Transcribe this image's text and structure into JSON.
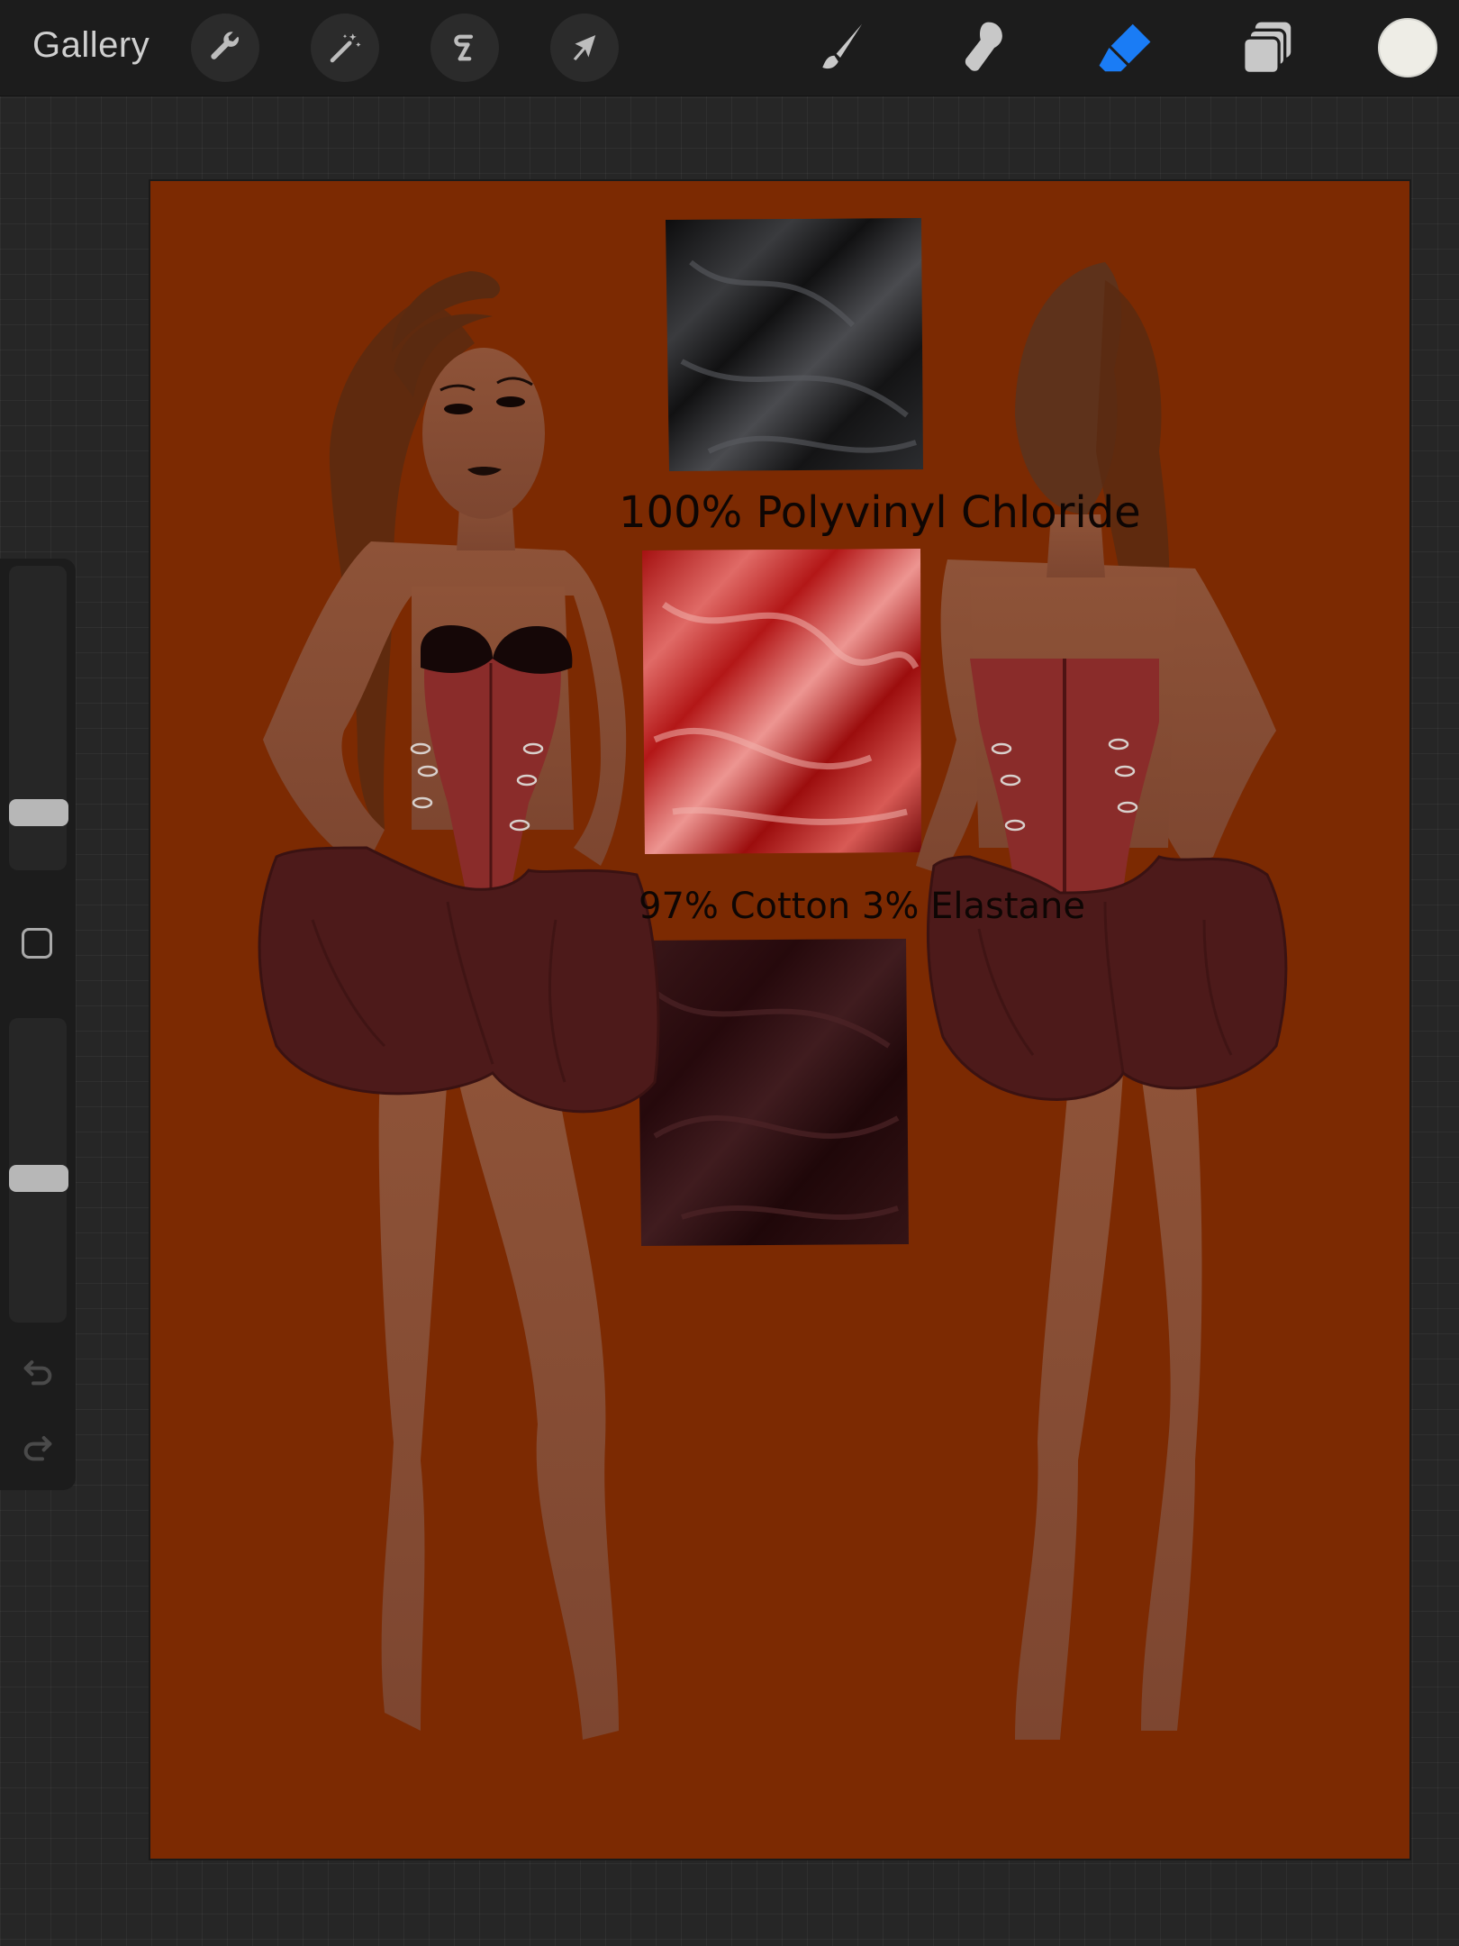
{
  "toolbar": {
    "gallery_label": "Gallery",
    "actions_icon": "wrench-icon",
    "adjustments_icon": "magic-wand-icon",
    "selection_icon": "selection-s-icon",
    "transform_icon": "arrow-cursor-icon",
    "brush_icon": "brush-icon",
    "smudge_icon": "smudge-finger-icon",
    "eraser_icon": "eraser-icon",
    "layers_icon": "layers-icon",
    "active_tool": "eraser",
    "accent_color": "#1a7cf5",
    "current_color": "#eeede6"
  },
  "sidebar": {
    "brush_size_level": 0.16,
    "opacity_level": 0.47,
    "modify_icon": "square-icon",
    "undo_icon": "undo-icon",
    "redo_icon": "redo-icon"
  },
  "canvas": {
    "background_color": "#7c2a02",
    "fabric_label_1": "100% Polyvinyl Chloride",
    "fabric_label_2": "97% Cotton 3% Elastane"
  }
}
